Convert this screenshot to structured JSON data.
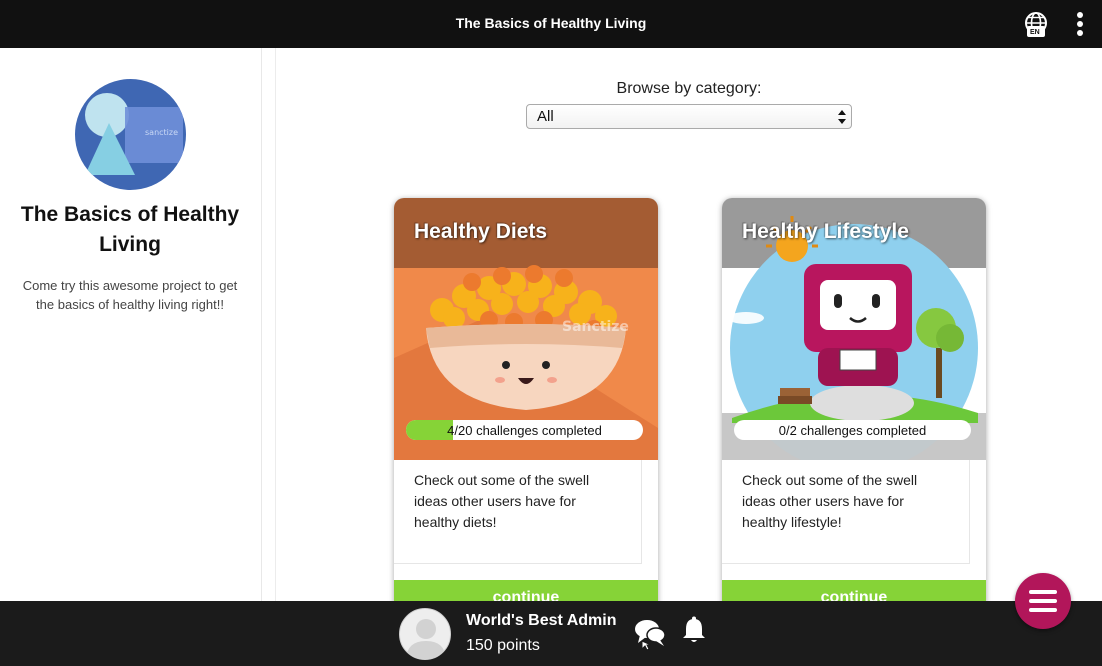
{
  "topbar": {
    "title": "The Basics of Healthy Living",
    "language": "EN",
    "icons": {
      "language": "globe-icon",
      "menu": "kebab-menu-icon"
    }
  },
  "sidebar": {
    "project_title": "The Basics of Healthy Living",
    "project_description": "Come try this awesome project to get the basics of healthy living right!!"
  },
  "browse": {
    "label": "Browse by category:",
    "selected": "All"
  },
  "cards": [
    {
      "title": "Healthy Diets",
      "progress_text": "4/20 challenges completed",
      "progress_fraction": 0.2,
      "description": "Check out some of the swell ideas other users have for healthy diets!",
      "button": "continue"
    },
    {
      "title": "Healthy Lifestyle",
      "progress_text": "0/2 challenges completed",
      "progress_fraction": 0,
      "description": "Check out some of the swell ideas other users have for healthy lifestyle!",
      "button": "continue"
    }
  ],
  "user": {
    "name": "World's Best Admin",
    "points": "150 points"
  },
  "colors": {
    "topbar": "#111111",
    "bottombar": "#1b1b1b",
    "accent_green": "#86d337",
    "fab": "#b2165a"
  }
}
